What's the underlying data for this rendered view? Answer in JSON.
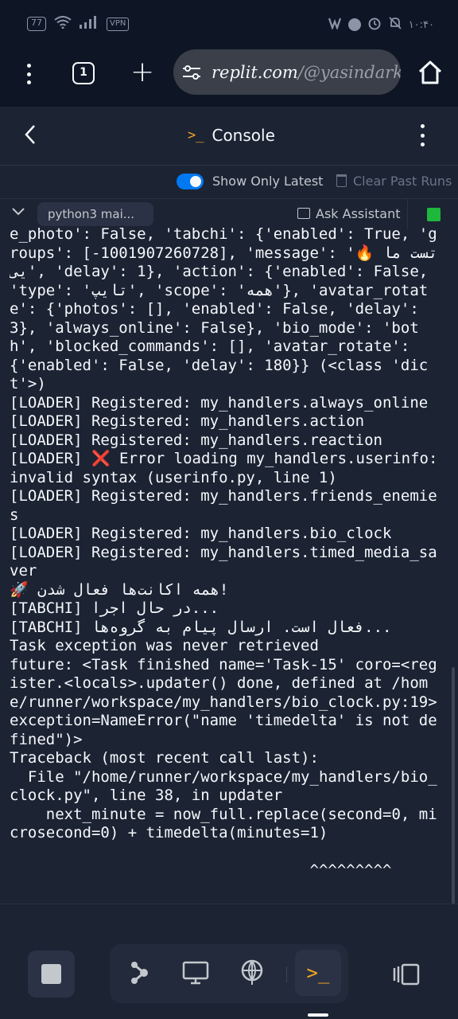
{
  "status_bar": {
    "battery": "77",
    "vpn": "VPN",
    "clock": "۱۰:۴۰"
  },
  "browser": {
    "tab_count": "1",
    "url_domain": "replit.com",
    "url_path": "/@yasindark"
  },
  "header": {
    "title": "Console"
  },
  "toolbar": {
    "show_only_latest": "Show Only Latest",
    "clear_past_runs": "Clear Past Runs"
  },
  "run": {
    "name": "python3 mai...",
    "ask_assistant": "Ask Assistant"
  },
  "console_lines": [
    "e_photo': False, 'tabchi': {'enabled': True, 'groups': [-1001907260728], 'message': '🔥 تست مایی', 'delay': 1}, 'action': {'enabled': False, 'type': 'تایپ', 'scope': 'همه'}, 'avatar_rotate': {'photos': [], 'enabled': False, 'delay': 3}, 'always_online': False}, 'bio_mode': 'both', 'blocked_commands': [], 'avatar_rotate': {'enabled': False, 'delay': 180}} (<class 'dict'>)",
    "[LOADER] Registered: my_handlers.always_online",
    "[LOADER] Registered: my_handlers.action",
    "[LOADER] Registered: my_handlers.reaction",
    "[LOADER] ❌ Error loading my_handlers.userinfo: invalid syntax (userinfo.py, line 1)",
    "[LOADER] Registered: my_handlers.friends_enemies",
    "[LOADER] Registered: my_handlers.bio_clock",
    "[LOADER] Registered: my_handlers.timed_media_saver",
    "🚀 همه اکانت‌ها فعال شدن!",
    "[TABCHI] در حال اجرا...",
    "[TABCHI] فعال است. ارسال پیام به گروه‌ها...",
    "Task exception was never retrieved",
    "future: <Task finished name='Task-15' coro=<register.<locals>.updater() done, defined at /home/runner/workspace/my_handlers/bio_clock.py:19> exception=NameError(\"name 'timedelta' is not defined\")>",
    "Traceback (most recent call last):",
    "  File \"/home/runner/workspace/my_handlers/bio_clock.py\", line 38, in updater",
    "    next_minute = now_full.replace(second=0, microsecond=0) + timedelta(minutes=1)",
    "",
    "                                 ^^^^^^^^^"
  ]
}
